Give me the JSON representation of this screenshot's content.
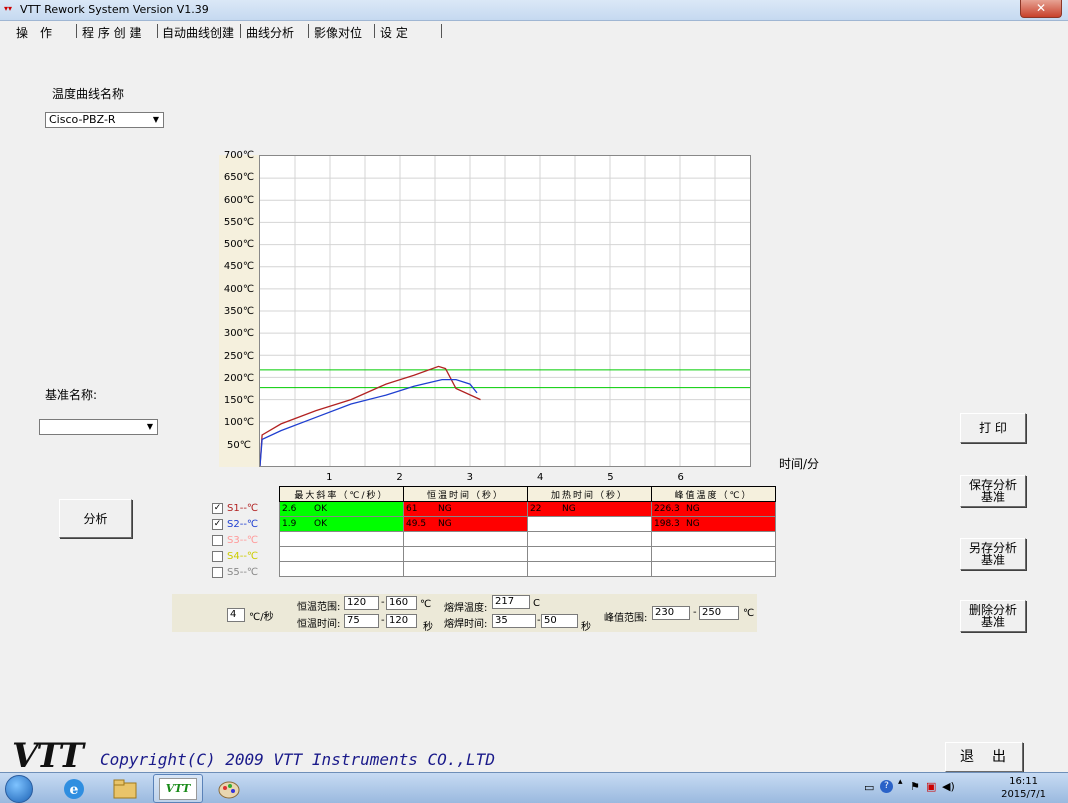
{
  "window": {
    "title": "VTT Rework System Version V1.39",
    "close_label": "✕"
  },
  "menu": [
    {
      "label": "操　作"
    },
    {
      "label": "程 序 创 建"
    },
    {
      "label": "自动曲线创建"
    },
    {
      "label": "曲线分析"
    },
    {
      "label": "影像对位"
    },
    {
      "label": "设 定"
    }
  ],
  "left": {
    "curve_name_label": "温度曲线名称",
    "curve_name_value": "Cisco-PBZ-R",
    "baseline_label": "基准名称:",
    "baseline_value": "",
    "analyze_button": "分析"
  },
  "right_buttons": {
    "print": "打 印",
    "save_baseline": "保存分析基准",
    "save_as_baseline": "另存分析基准",
    "delete_baseline": "删除分析基准"
  },
  "chart_data": {
    "type": "line",
    "y_ticks": [
      "700℃",
      "650℃",
      "600℃",
      "550℃",
      "500℃",
      "450℃",
      "400℃",
      "350℃",
      "300℃",
      "250℃",
      "200℃",
      "150℃",
      "100℃",
      "50℃"
    ],
    "x_ticks": [
      "1",
      "2",
      "3",
      "4",
      "5",
      "6"
    ],
    "xlabel": "时间/分",
    "ylim": [
      0,
      700
    ],
    "xlim": [
      0,
      7
    ],
    "grid": true,
    "reference_lines": [
      {
        "y": 217,
        "color": "#00cc00"
      },
      {
        "y": 177,
        "color": "#00cc00"
      }
    ],
    "series": [
      {
        "name": "S1",
        "color": "#b22222",
        "x": [
          0,
          0.03,
          0.3,
          0.8,
          1.3,
          1.8,
          2.2,
          2.55,
          2.65,
          2.8,
          3.15
        ],
        "y": [
          0,
          70,
          95,
          125,
          150,
          185,
          205,
          225,
          220,
          175,
          150
        ]
      },
      {
        "name": "S2",
        "color": "#1f3fd0",
        "x": [
          0,
          0.03,
          0.3,
          0.8,
          1.3,
          1.8,
          2.2,
          2.6,
          2.8,
          3.0,
          3.1
        ],
        "y": [
          0,
          60,
          80,
          110,
          140,
          160,
          180,
          195,
          195,
          185,
          165
        ]
      }
    ]
  },
  "series_legend": [
    {
      "label": "S1--℃",
      "checked": true,
      "color": "#b22222"
    },
    {
      "label": "S2--℃",
      "checked": true,
      "color": "#1f3fd0"
    },
    {
      "label": "S3--℃",
      "checked": false,
      "color": "#ff9999"
    },
    {
      "label": "S4--℃",
      "checked": false,
      "color": "#cccc00"
    },
    {
      "label": "S5--℃",
      "checked": false,
      "color": "#888888"
    }
  ],
  "results_table": {
    "headers": [
      "最大斜率（℃/秒）",
      "恒温时间（秒）",
      "加热时间（秒）",
      "峰值温度（℃）"
    ],
    "rows": [
      [
        {
          "value": "2.6",
          "status": "OK"
        },
        {
          "value": "61",
          "status": "NG"
        },
        {
          "value": "22",
          "status": "NG"
        },
        {
          "value": "226.3",
          "status": "NG"
        }
      ],
      [
        {
          "value": "1.9",
          "status": "OK"
        },
        {
          "value": "49.5",
          "status": "NG"
        },
        {
          "value": "",
          "status": ""
        },
        {
          "value": "198.3",
          "status": "NG"
        }
      ],
      [
        {
          "value": "",
          "status": ""
        },
        {
          "value": "",
          "status": ""
        },
        {
          "value": "",
          "status": ""
        },
        {
          "value": "",
          "status": ""
        }
      ],
      [
        {
          "value": "",
          "status": ""
        },
        {
          "value": "",
          "status": ""
        },
        {
          "value": "",
          "status": ""
        },
        {
          "value": "",
          "status": ""
        }
      ],
      [
        {
          "value": "",
          "status": ""
        },
        {
          "value": "",
          "status": ""
        },
        {
          "value": "",
          "status": ""
        },
        {
          "value": "",
          "status": ""
        }
      ]
    ]
  },
  "params": {
    "slope_value": "4",
    "slope_unit": "℃/秒",
    "soak_range_label": "恒温范围:",
    "soak_range_min": "120",
    "soak_range_max": "160",
    "soak_range_unit": "℃",
    "soak_time_label": "恒温时间:",
    "soak_time_min": "75",
    "soak_time_max": "120",
    "soak_time_unit": "秒",
    "reflow_temp_label": "熔焊温度:",
    "reflow_temp_value": "217",
    "reflow_temp_unit": "C",
    "reflow_time_label": "熔焊时间:",
    "reflow_time_min": "35",
    "reflow_time_max": "50",
    "reflow_time_unit": "秒",
    "peak_range_label": "峰值范围:",
    "peak_range_min": "230",
    "peak_range_max": "250",
    "peak_range_unit": "℃",
    "dash": "-"
  },
  "footer": {
    "logo": "VTT",
    "copyright": "Copyright(C) 2009 VTT Instruments CO.,LTD",
    "exit_button": "退　出"
  },
  "taskbar": {
    "active_app_label": "VTT",
    "time": "16:11",
    "date": "2015/7/1"
  }
}
